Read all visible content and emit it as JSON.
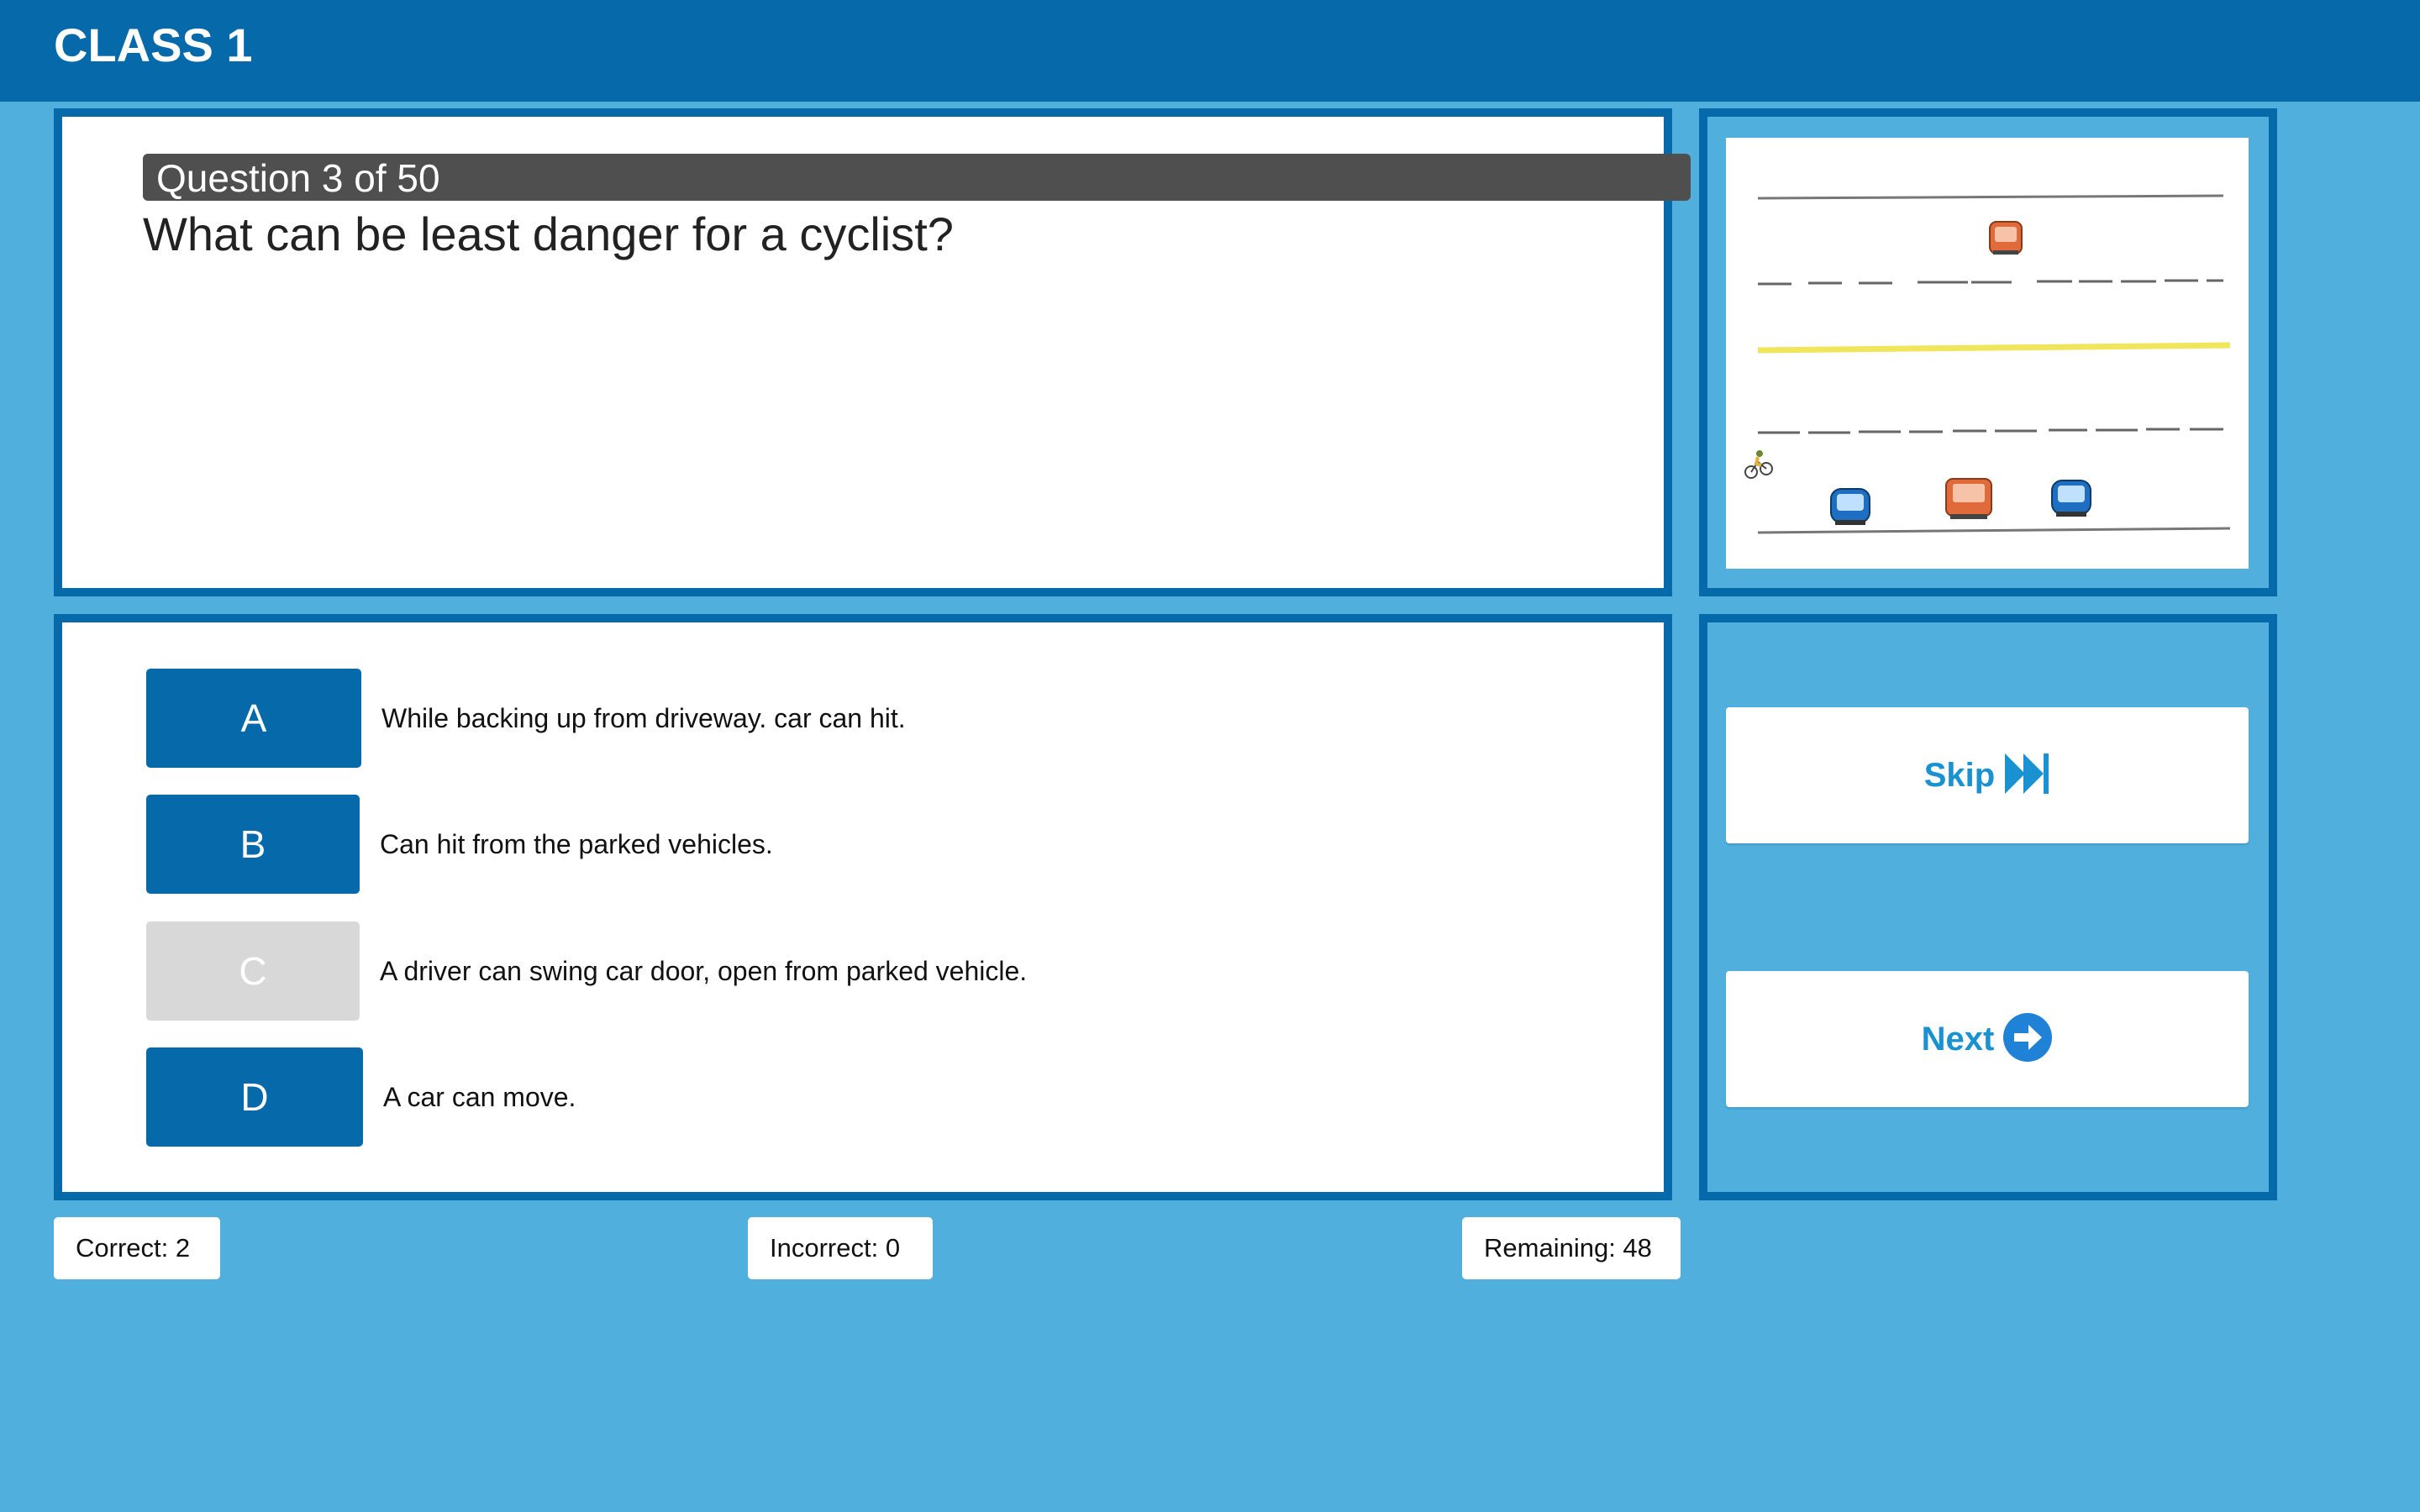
{
  "header": {
    "title": "CLASS 1"
  },
  "question": {
    "counter": "Question 3 of 50",
    "text": "What can be least danger for a cyclist?"
  },
  "illustration": {
    "icon": "road-scene-image",
    "colors": {
      "center_line": "#f1e55c",
      "lane_marks": "#555555",
      "car_blue": "#1e6fc2",
      "truck_orange": "#e06a3a"
    }
  },
  "answers": [
    {
      "letter": "A",
      "text": "While backing up from driveway. car can hit.",
      "disabled": false
    },
    {
      "letter": "B",
      "text": "Can hit from the parked vehicles.",
      "disabled": false
    },
    {
      "letter": "C",
      "text": "A driver can swing car door, open from parked vehicle.",
      "disabled": true
    },
    {
      "letter": "D",
      "text": "A car can move.",
      "disabled": false
    }
  ],
  "actions": {
    "skip_label": "Skip",
    "skip_icon": "fast-forward-icon",
    "next_label": "Next",
    "next_icon": "arrow-right-circle-icon"
  },
  "stats": {
    "correct": "Correct: 2",
    "incorrect": "Incorrect: 0",
    "remaining": "Remaining: 48"
  },
  "colors": {
    "header_bg": "#0669aa",
    "page_bg": "#50afdc",
    "answer_button": "#0669aa",
    "answer_disabled": "#d8d8d8",
    "action_text": "#1a91d1"
  }
}
